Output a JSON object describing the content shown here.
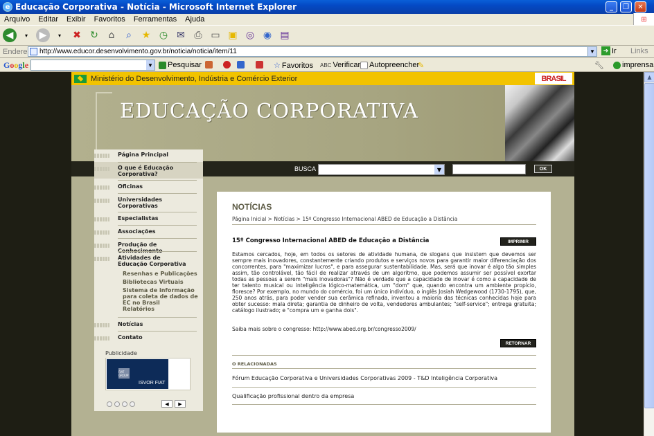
{
  "window": {
    "title": "Educação Corporativa - Notícia - Microsoft Internet Explorer"
  },
  "menu": [
    "Arquivo",
    "Editar",
    "Exibir",
    "Favoritos",
    "Ferramentas",
    "Ajuda"
  ],
  "address": {
    "label": "Endereço",
    "url": "http://www.educor.desenvolvimento.gov.br/noticia/noticia/item/11",
    "go": "Ir",
    "links": "Links"
  },
  "google": {
    "logo": "Google",
    "search_label": "Pesquisar",
    "favorites": "Favoritos",
    "check": "Verificar",
    "autofill": "Autopreencher",
    "print": "imprensa"
  },
  "gov": {
    "ministry": "Ministério do Desenvolvimento, Indústria e Comércio Exterior",
    "brand": "BRASIL"
  },
  "site": {
    "logo": "EDUCAÇÃO CORPORATIVA",
    "search_label": "BUSCA",
    "ok": "OK"
  },
  "nav": {
    "items": [
      "Página Principal",
      "O que é Educação Corporativa?",
      "Oficinas",
      "Universidades Corporativas",
      "Especialistas",
      "Associações",
      "Produção de Conhecimento",
      "Atividades de Educação Corporativa",
      "Notícias",
      "Contato"
    ],
    "sub": [
      "Resenhas e Publicações",
      "Bibliotecas Virtuais",
      "Sistema de informação para coleta de dados de EC no Brasil",
      "Relatórios"
    ]
  },
  "pub": {
    "label": "Publicidade",
    "brand": "ISVOR FIAT",
    "fiat": "FIAT GROUP"
  },
  "article": {
    "heading": "NOTÍCIAS",
    "breadcrumb": "Página Inicial > Notícias > 15º Congresso Internacional ABED de Educação a Distância",
    "title": "15º Congresso Internacional ABED de Educação a Distância",
    "print": "IMPRIMIR",
    "body": "Estamos cercados, hoje, em todos os setores de atividade humana, de slogans que insistem que devemos ser sempre mais inovadores, constantemente criando produtos e serviços novos para garantir maior diferenciação dos concorrentes, para \"maximizar lucros\", e para assegurar sustentabilidade. Mas, será que inovar é algo tão simples assim, tão controlável, tão fácil de realizar através de um algoritmo, que podemos assumir ser possível exortar todas as pessoas a serem \"mais inovadoras\"? Não é verdade que a capacidade de inovar é como a capacidade de ter talento musical ou inteligência lógico-matemática, um \"dom\" que, quando encontra um ambiente propício, floresce? Por exemplo, no mundo do comércio, foi um único indivíduo, o inglês Josiah Wedgewood (1730-1795), que, 250 anos atrás, para poder vender sua cerâmica refinada, inventou a maioria das técnicas conhecidas hoje para obter sucesso: mala direta; garantia de dinheiro de volta, vendedores ambulantes; \"self-service\"; entrega gratuita; catálogo ilustrado; e \"compra um e ganha dois\".",
    "more": "Saiba mais sobre o congresso: http://www.abed.org.br/congresso2009/",
    "back": "RETORNAR",
    "related_label": "O RELACIONADAS",
    "related": [
      "Fórum Educação Corporativa e Universidades Corporativas 2009 - T&D Inteligência Corporativa",
      "Qualificação profissional dentro da empresa"
    ]
  }
}
